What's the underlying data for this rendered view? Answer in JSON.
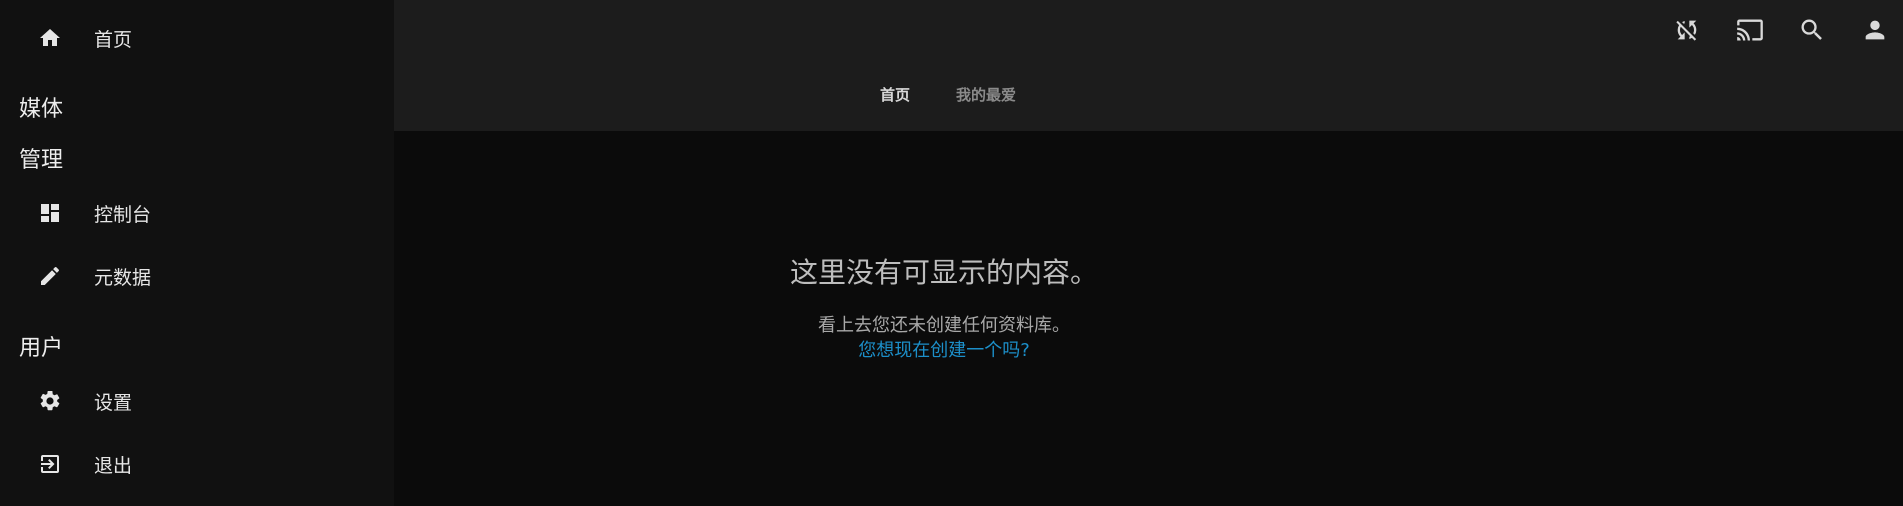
{
  "sidebar": {
    "home_label": "首页",
    "sections": {
      "media": "媒体",
      "admin": "管理",
      "user": "用户"
    },
    "admin_items": [
      {
        "label": "控制台",
        "icon": "dashboard-icon"
      },
      {
        "label": "元数据",
        "icon": "edit-icon"
      }
    ],
    "user_items": [
      {
        "label": "设置",
        "icon": "gear-icon"
      },
      {
        "label": "退出",
        "icon": "logout-icon"
      }
    ]
  },
  "header": {
    "icons": [
      "sync-disabled-icon",
      "cast-icon",
      "search-icon",
      "user-icon"
    ],
    "tabs": [
      {
        "label": "首页",
        "active": true
      },
      {
        "label": "我的最爱",
        "active": false
      }
    ]
  },
  "main": {
    "empty_title": "这里没有可显示的内容。",
    "empty_description": "看上去您还未创建任何资料库。",
    "create_link": "您想现在创建一个吗?"
  },
  "colors": {
    "sidebar_bg": "#111111",
    "header_bg": "#1c1c1c",
    "main_bg": "#0b0b0b",
    "link": "#1c8fc9"
  }
}
